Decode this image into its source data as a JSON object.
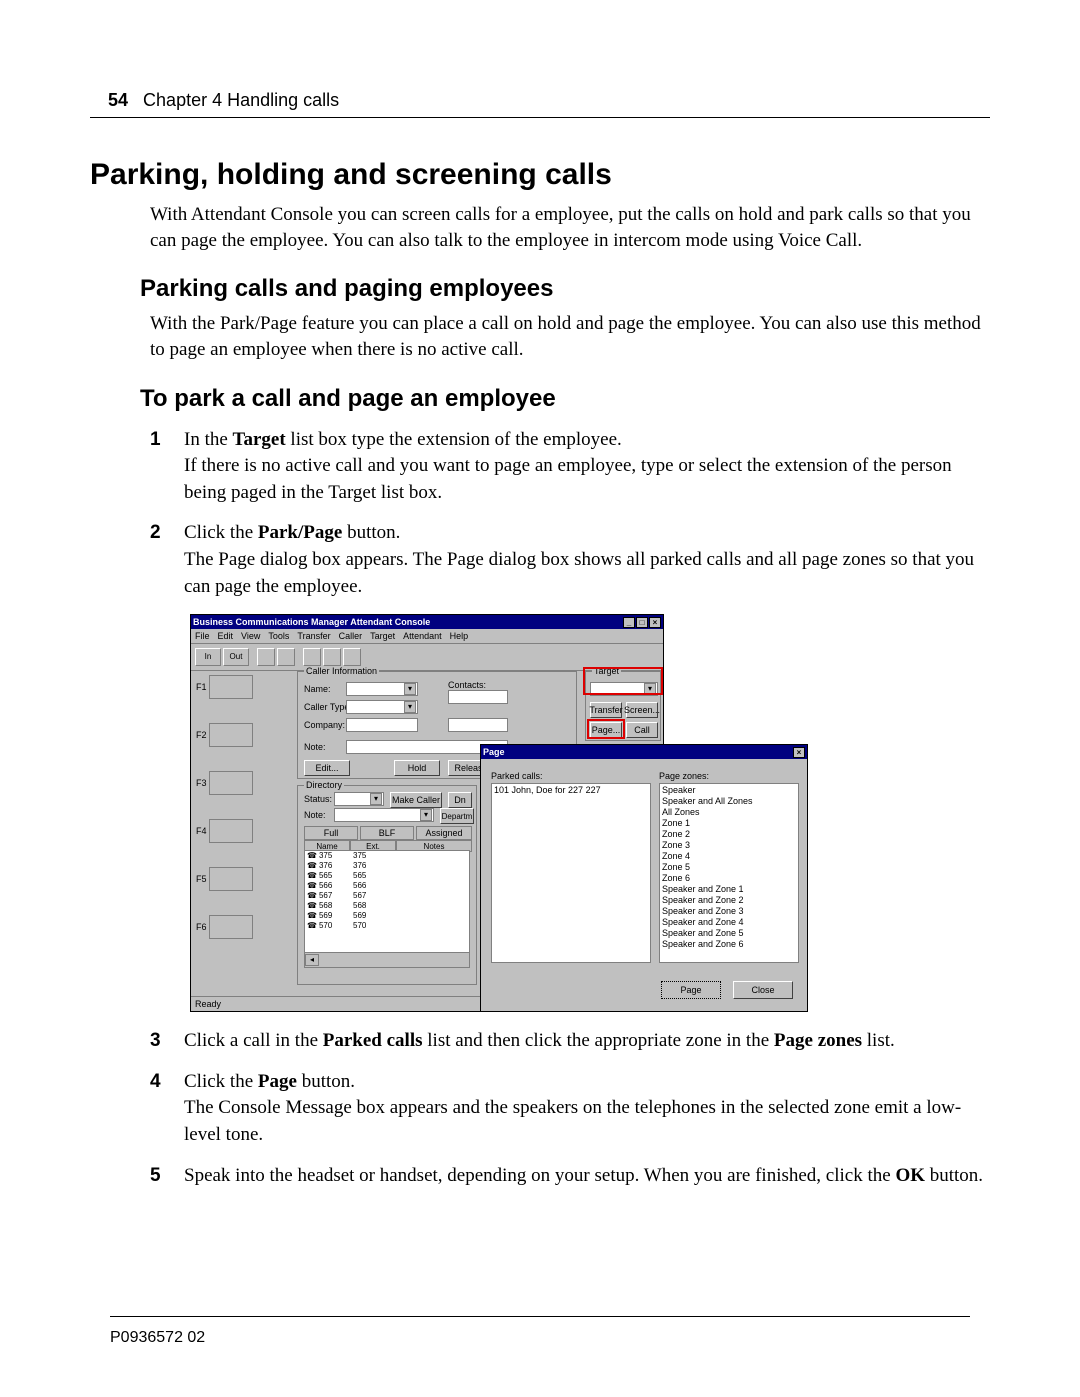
{
  "header": {
    "page_num": "54",
    "chapter": "Chapter 4  Handling calls"
  },
  "h1": "Parking, holding and screening calls",
  "intro": "With Attendant Console you can screen calls for a employee, put the calls on hold and park calls so that you can page the employee. You can also talk to the employee in intercom mode using Voice Call.",
  "h2a": "Parking calls and paging employees",
  "p2a": "With the Park/Page feature you can place a call on hold and page the employee. You can also use this method to page an employee when there is no active call.",
  "h2b": "To park a call and page an employee",
  "steps": {
    "s1_a": "In the ",
    "s1_b": "Target",
    "s1_c": " list box type the extension of the employee.",
    "s1_d": "If there is no active call and you want to page an employee, type or select the extension of the person being paged in the Target list box.",
    "s2_a": "Click the ",
    "s2_b": "Park/Page",
    "s2_c": " button.",
    "s2_d": "The Page dialog box appears. The Page dialog box shows all parked calls and all page zones so that you can page the employee.",
    "s3_a": "Click a call in the ",
    "s3_b": "Parked calls",
    "s3_c": " list and then click the appropriate zone in the ",
    "s3_d": "Page zones",
    "s3_e": " list.",
    "s4_a": "Click the ",
    "s4_b": "Page",
    "s4_c": " button.",
    "s4_d": "The Console Message box appears and the speakers on the telephones in the selected zone emit a low-level tone.",
    "s5_a": "Speak into the headset or handset, depending on your setup. When you are finished, click the ",
    "s5_b": "OK",
    "s5_c": " button."
  },
  "footer": "P0936572 02",
  "app": {
    "title": "Business Communications Manager Attendant Console",
    "menu": [
      "File",
      "Edit",
      "View",
      "Tools",
      "Transfer",
      "Caller",
      "Target",
      "Attendant",
      "Help"
    ],
    "fkeys": [
      "F1",
      "F2",
      "F3",
      "F4",
      "F5",
      "F6"
    ],
    "caller_info": {
      "group": "Caller Information",
      "name": "Name:",
      "type": "Caller Type:",
      "company": "Company:",
      "note": "Note:",
      "contacts": "Contacts:",
      "edit": "Edit...",
      "hold": "Hold",
      "release": "Release"
    },
    "target": {
      "group": "Target",
      "transfer": "Transfer",
      "screen": "Screen...",
      "page": "Page...",
      "call": "Call"
    },
    "directory": {
      "group": "Directory",
      "status": "Status:",
      "note": "Note:",
      "make_caller": "Make Caller",
      "dn": "Dn",
      "departm": "Departm",
      "tabs": [
        "Full",
        "BLF",
        "Assigned"
      ],
      "cols": [
        "Name",
        "Ext.",
        "Notes"
      ],
      "rows": [
        {
          "ext": "375",
          "num": "375"
        },
        {
          "ext": "376",
          "num": "376"
        },
        {
          "ext": "565",
          "num": "565"
        },
        {
          "ext": "566",
          "num": "566"
        },
        {
          "ext": "567",
          "num": "567"
        },
        {
          "ext": "568",
          "num": "568"
        },
        {
          "ext": "569",
          "num": "569"
        },
        {
          "ext": "570",
          "num": "570"
        }
      ]
    },
    "status": "Ready"
  },
  "dialog": {
    "title": "Page",
    "parked_label": "Parked calls:",
    "zones_label": "Page zones:",
    "parked_entry": "101 John, Doe  for 227 227",
    "zones": [
      "Speaker",
      "Speaker and All Zones",
      "All Zones",
      "Zone 1",
      "Zone 2",
      "Zone 3",
      "Zone 4",
      "Zone 5",
      "Zone 6",
      "Speaker and Zone 1",
      "Speaker and Zone 2",
      "Speaker and Zone 3",
      "Speaker and Zone 4",
      "Speaker and Zone 5",
      "Speaker and Zone 6"
    ],
    "page_btn": "Page",
    "close_btn": "Close"
  }
}
